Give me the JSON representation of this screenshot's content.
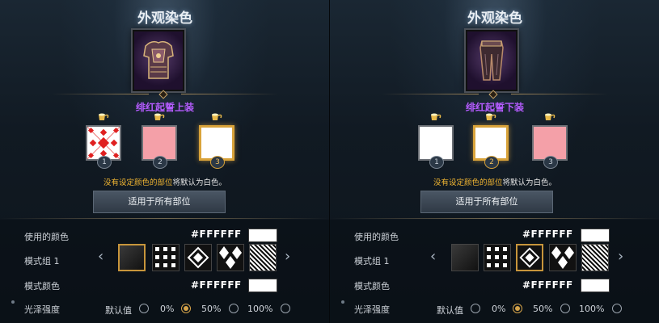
{
  "panels": [
    {
      "title": "外观染色",
      "item_name": "绯红起誓上装",
      "slots": [
        {
          "num": "1",
          "color": "#e02020",
          "pattern": "red-white-diamond",
          "selected": false
        },
        {
          "num": "2",
          "color": "#f4a0a8",
          "pattern": "solid",
          "selected": false
        },
        {
          "num": "3",
          "color": "#ffffff",
          "pattern": "solid",
          "selected": true
        }
      ],
      "notice_highlight": "没有设定颜色的部位",
      "notice_rest": "将默认为白色。",
      "apply_label": "适用于所有部位",
      "color_used_label": "使用的颜色",
      "color_used_value": "#FFFFFF",
      "pattern_group_label": "模式组 1",
      "pattern_color_label": "模式颜色",
      "pattern_color_value": "#FFFFFF",
      "gloss_label": "光泽强度",
      "gloss_options": [
        "默认值",
        "0%",
        "50%",
        "100%"
      ],
      "gloss_selected": "0%",
      "selected_pattern_index": 0
    },
    {
      "title": "外观染色",
      "item_name": "绯红起誓下装",
      "slots": [
        {
          "num": "1",
          "color": "#ffffff",
          "pattern": "solid",
          "selected": false
        },
        {
          "num": "2",
          "color": "#ffffff",
          "pattern": "solid",
          "selected": true
        },
        {
          "num": "3",
          "color": "#f4a0a8",
          "pattern": "solid",
          "selected": false
        }
      ],
      "notice_highlight": "没有设定颜色的部位",
      "notice_rest": "将默认为白色。",
      "apply_label": "适用于所有部位",
      "color_used_label": "使用的颜色",
      "color_used_value": "#FFFFFF",
      "pattern_group_label": "模式组 1",
      "pattern_color_label": "模式颜色",
      "pattern_color_value": "#FFFFFF",
      "gloss_label": "光泽强度",
      "gloss_options": [
        "默认值",
        "0%",
        "50%",
        "100%"
      ],
      "gloss_selected": "0%",
      "selected_pattern_index": 2
    }
  ],
  "colors": {
    "accent_gold": "#d9a33a",
    "item_name_purple": "#b55cff",
    "notice_yellow": "#f2b632"
  }
}
